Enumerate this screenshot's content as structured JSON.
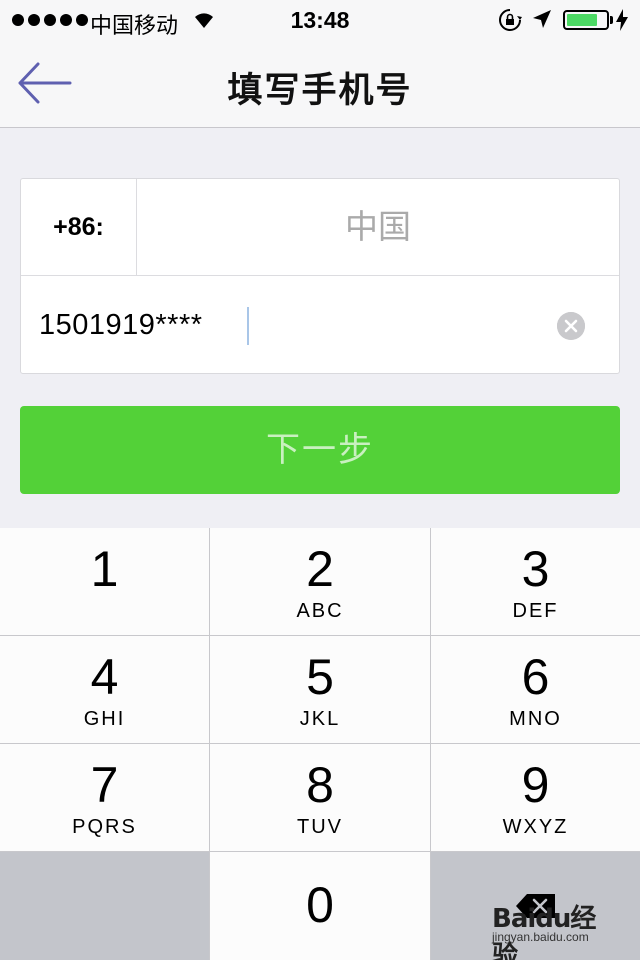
{
  "status_bar": {
    "carrier": "中国移动",
    "time": "13:48",
    "battery_level": 0.8,
    "signal_bars": 5
  },
  "nav": {
    "title": "填写手机号",
    "back_icon": "back-arrow-icon"
  },
  "form": {
    "country_code": "+86:",
    "country_name": "中国",
    "phone_value": "1501919****",
    "clear_icon": "clear-circle-icon"
  },
  "next_button": {
    "label": "下一步"
  },
  "keypad": {
    "keys": [
      {
        "num": "1",
        "letters": ""
      },
      {
        "num": "2",
        "letters": "ABC"
      },
      {
        "num": "3",
        "letters": "DEF"
      },
      {
        "num": "4",
        "letters": "GHI"
      },
      {
        "num": "5",
        "letters": "JKL"
      },
      {
        "num": "6",
        "letters": "MNO"
      },
      {
        "num": "7",
        "letters": "PQRS"
      },
      {
        "num": "8",
        "letters": "TUV"
      },
      {
        "num": "9",
        "letters": "WXYZ"
      },
      {
        "num": "0",
        "letters": ""
      }
    ],
    "delete_icon": "delete-key-icon"
  },
  "watermark": {
    "brand": "Baidu经验",
    "url": "jingyan.baidu.com"
  },
  "colors": {
    "accent_green": "#53d138",
    "back_arrow": "#5f60b0",
    "battery_green": "#4cd964"
  }
}
